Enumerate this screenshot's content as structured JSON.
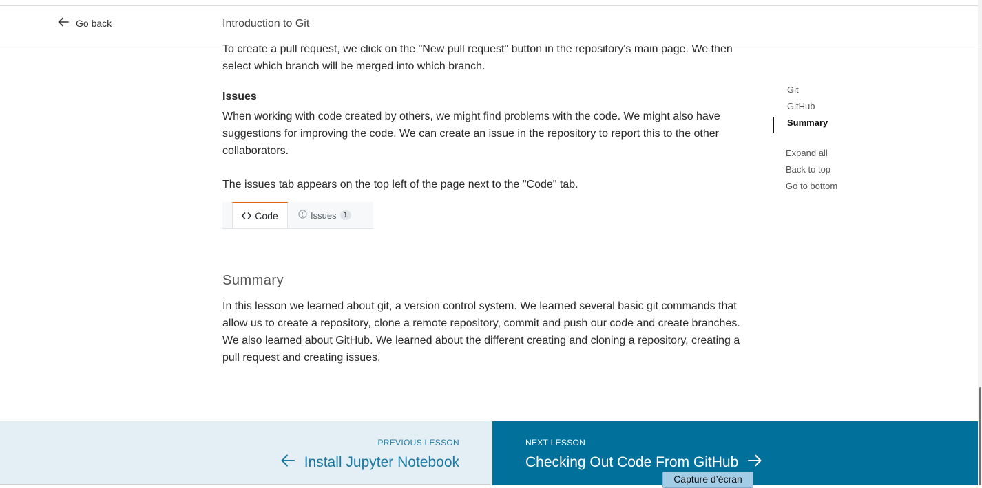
{
  "header": {
    "back_label": "Go back",
    "title": "Introduction to Git"
  },
  "content": {
    "intro_paragraph": "To create a pull request, we click on the \"New pull request\" button in the repository's main page. We then select which branch will be merged into which branch.",
    "issues_heading": "Issues",
    "issues_paragraph_1": "When working with code created by others, we might find problems with the code. We might also have suggestions for improving the code. We can create an issue in the repository to report this to the other collaborators.",
    "issues_paragraph_2": "The issues tab appears on the top left of the page next to the \"Code\" tab.",
    "tabs_image": {
      "code_tab": "Code",
      "issues_tab": "Issues",
      "issues_count": "1",
      "accent_color": "#e36209"
    },
    "summary_heading": "Summary",
    "summary_paragraph": "In this lesson we learned about git, a version control system. We learned several basic git commands that allow us to create a repository, clone a remote repository, commit and push our code and create branches. We also learned about GitHub. We learned about the different creating and cloning a repository, creating a pull request and creating issues."
  },
  "toc": {
    "items": [
      {
        "label": "Git",
        "active": false
      },
      {
        "label": "GitHub",
        "active": false
      },
      {
        "label": "Summary",
        "active": true
      }
    ],
    "expand_all": "Expand all",
    "back_to_top": "Back to top",
    "go_to_bottom": "Go to bottom"
  },
  "footer": {
    "previous_label": "PREVIOUS LESSON",
    "previous_title": "Install Jupyter Notebook",
    "next_label": "NEXT LESSON",
    "next_title": "Checking Out Code From GitHub",
    "next_bg_color": "#01719b",
    "prev_bg_color": "#e3eef5"
  },
  "tooltip": {
    "text": "Capture d’écran"
  },
  "icons": {
    "back": "arrow-left-icon",
    "code": "code-brackets-icon",
    "issues": "issue-opened-icon",
    "prev": "arrow-left-icon",
    "next": "arrow-right-icon"
  }
}
